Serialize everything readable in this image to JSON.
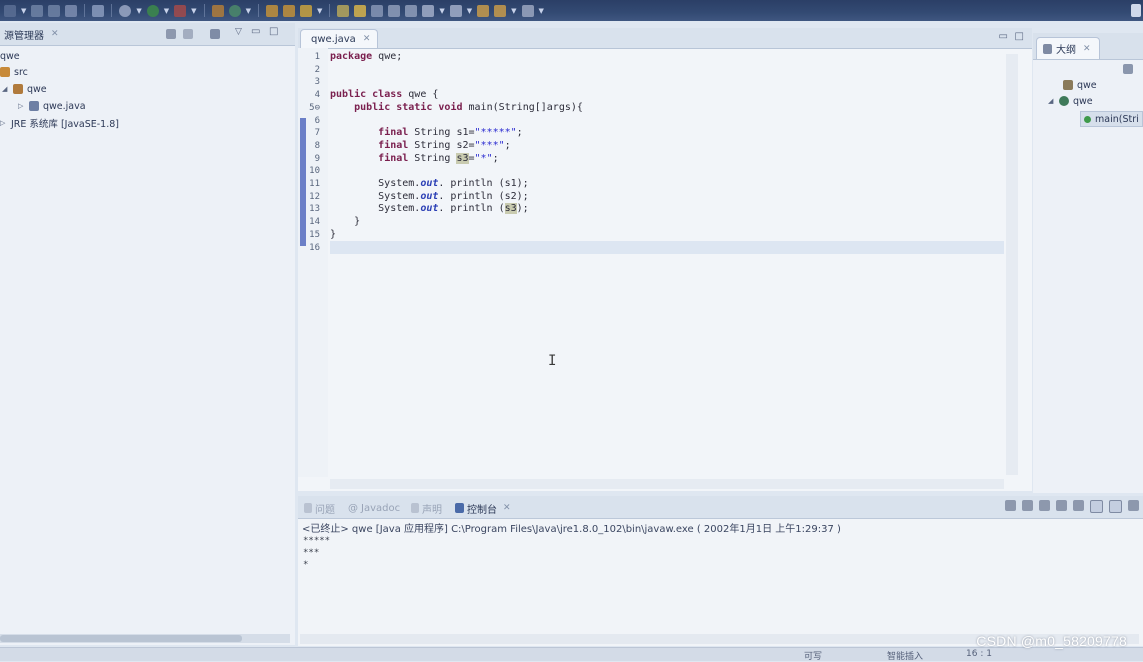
{
  "left_panel": {
    "title": "源管理器",
    "tree": [
      {
        "label": "qwe"
      },
      {
        "label": "src"
      },
      {
        "label": "qwe"
      },
      {
        "label": "qwe.java"
      },
      {
        "label": "JRE 系统库 [JavaSE-1.8]"
      }
    ]
  },
  "editor": {
    "tab_label": "qwe.java",
    "lines": [
      {
        "n": "1",
        "tokens": [
          {
            "t": "package",
            "c": "kw"
          },
          {
            "t": " qwe;"
          }
        ]
      },
      {
        "n": "2",
        "tokens": []
      },
      {
        "n": "3",
        "tokens": []
      },
      {
        "n": "4",
        "tokens": [
          {
            "t": "public",
            "c": "kw"
          },
          {
            "t": " "
          },
          {
            "t": "class",
            "c": "kw"
          },
          {
            "t": " qwe {"
          }
        ]
      },
      {
        "n": "5⊖",
        "tokens": [
          {
            "t": "    "
          },
          {
            "t": "public",
            "c": "kw"
          },
          {
            "t": " "
          },
          {
            "t": "static",
            "c": "kw"
          },
          {
            "t": " "
          },
          {
            "t": "void",
            "c": "kw"
          },
          {
            "t": " main(String[]args){"
          }
        ]
      },
      {
        "n": "6",
        "tokens": []
      },
      {
        "n": "7",
        "tokens": [
          {
            "t": "        "
          },
          {
            "t": "final",
            "c": "kw"
          },
          {
            "t": " String s1="
          },
          {
            "t": "\"*****\"",
            "c": "str"
          },
          {
            "t": ";"
          }
        ]
      },
      {
        "n": "8",
        "tokens": [
          {
            "t": "        "
          },
          {
            "t": "final",
            "c": "kw"
          },
          {
            "t": " String s2="
          },
          {
            "t": "\"***\"",
            "c": "str"
          },
          {
            "t": ";"
          }
        ]
      },
      {
        "n": "9",
        "tokens": [
          {
            "t": "        "
          },
          {
            "t": "final",
            "c": "kw"
          },
          {
            "t": " String "
          },
          {
            "t": "s3",
            "c": "hl"
          },
          {
            "t": "="
          },
          {
            "t": "\"*\"",
            "c": "str"
          },
          {
            "t": ";"
          }
        ]
      },
      {
        "n": "10",
        "tokens": []
      },
      {
        "n": "11",
        "tokens": [
          {
            "t": "        System."
          },
          {
            "t": "out",
            "c": "fld"
          },
          {
            "t": ". println (s1);"
          }
        ]
      },
      {
        "n": "12",
        "tokens": [
          {
            "t": "        System."
          },
          {
            "t": "out",
            "c": "fld"
          },
          {
            "t": ". println (s2);"
          }
        ]
      },
      {
        "n": "13",
        "tokens": [
          {
            "t": "        System."
          },
          {
            "t": "out",
            "c": "fld"
          },
          {
            "t": ". println ("
          },
          {
            "t": "s3",
            "c": "hl"
          },
          {
            "t": ");"
          }
        ]
      },
      {
        "n": "14",
        "tokens": [
          {
            "t": "    }"
          }
        ]
      },
      {
        "n": "15",
        "tokens": [
          {
            "t": "}"
          }
        ]
      },
      {
        "n": "16",
        "tokens": []
      }
    ]
  },
  "outline": {
    "title": "大纲",
    "items": [
      {
        "label": "qwe"
      },
      {
        "label": "qwe"
      },
      {
        "label": "main(Stri"
      }
    ]
  },
  "console": {
    "tabs": [
      "问题",
      "Javadoc",
      "声明",
      "控制台"
    ],
    "header": "<已终止> qwe [Java 应用程序] C:\\Program Files\\Java\\jre1.8.0_102\\bin\\javaw.exe ( 2002年1月1日 上午1:29:37 )",
    "output": [
      "*****",
      "***",
      "*"
    ]
  },
  "status": {
    "writable": "可写",
    "insert_mode": "智能插入",
    "position": "16 : 1"
  },
  "watermark": "CSDN @m0_58209778"
}
